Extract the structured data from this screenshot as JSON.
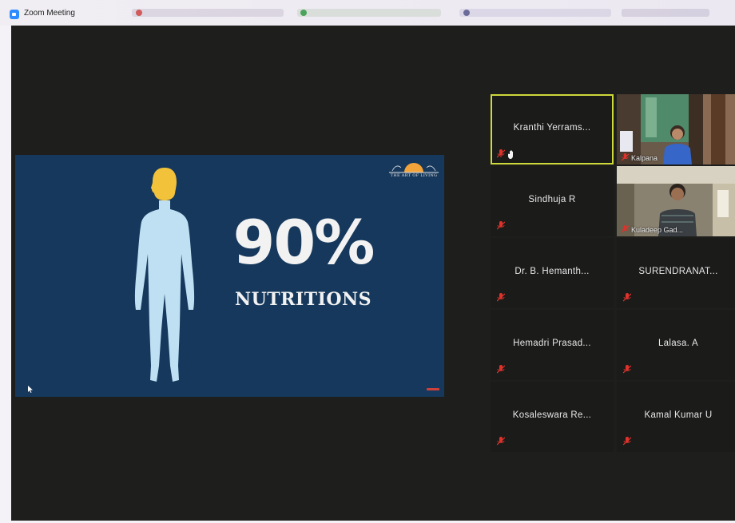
{
  "window": {
    "title": "Zoom Meeting"
  },
  "shared_screen": {
    "stat": "90%",
    "headline": "NUTRITIONS",
    "logo_text": "THE ART OF LIVING"
  },
  "participants": [
    {
      "name": "Kranthi Yerrams...",
      "video": false,
      "muted": true,
      "active_speaker": true,
      "hand_raised": true
    },
    {
      "name": "Kalpana",
      "video": true,
      "muted": true
    },
    {
      "name": "Sindhuja R",
      "video": false,
      "muted": true
    },
    {
      "name": "Kuladeep Gad...",
      "video": true,
      "muted": true
    },
    {
      "name": "Dr. B. Hemanth...",
      "video": false,
      "muted": true
    },
    {
      "name": "SURENDRANAT...",
      "video": false,
      "muted": true
    },
    {
      "name": "Hemadri Prasad...",
      "video": false,
      "muted": true
    },
    {
      "name": "Lalasa. A",
      "video": false,
      "muted": true
    },
    {
      "name": "Kosaleswara Re...",
      "video": false,
      "muted": true
    },
    {
      "name": "Kamal Kumar U",
      "video": false,
      "muted": true
    }
  ],
  "colors": {
    "meeting_bg": "#1e1f1c",
    "slide_bg": "#15385c",
    "active_speaker_border": "#cfd93a",
    "mute_icon": "#e0322b",
    "head_highlight": "#f2c23a",
    "body_silhouette": "#bfe0f3"
  },
  "icons": {
    "app": "zoom-app-icon",
    "mute": "mic-muted-icon",
    "hand": "raised-hand-icon",
    "cursor": "mouse-pointer-icon"
  }
}
